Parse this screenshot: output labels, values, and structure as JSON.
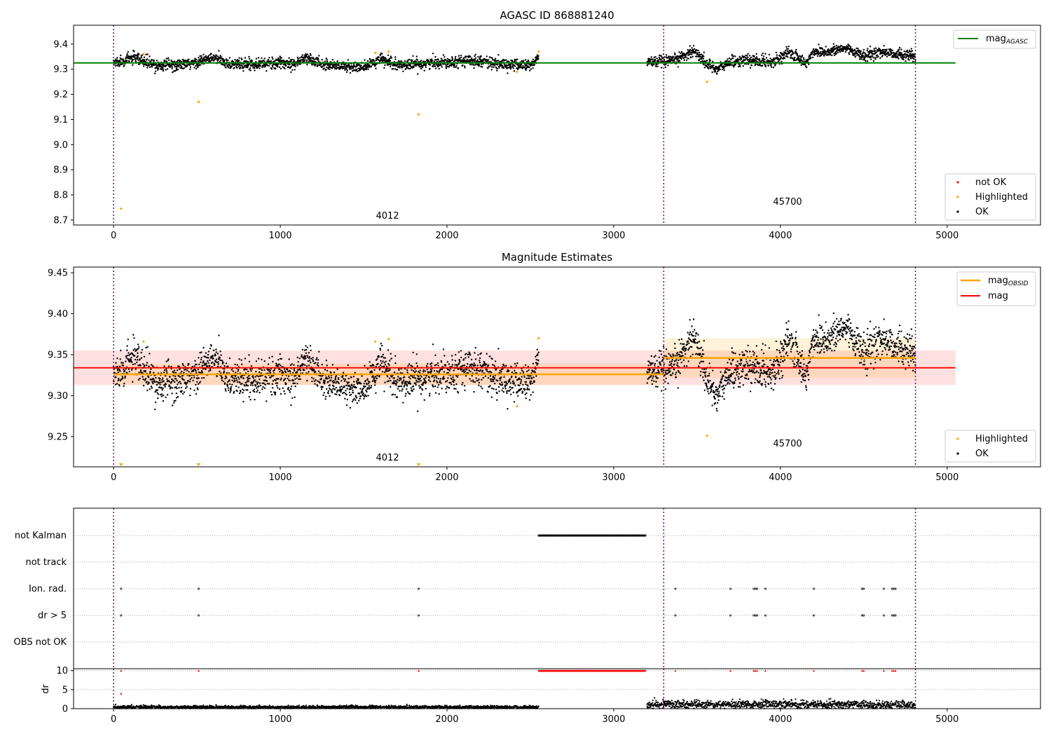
{
  "figure": {
    "panels": {
      "top": {
        "title": "AGASC ID 868881240",
        "legend_line": "mag",
        "legend_line_sub": "AGASC",
        "legend_points": [
          "not OK",
          "Highlighted",
          "OK"
        ],
        "annot_left": "4012",
        "annot_right": "45700"
      },
      "middle": {
        "title": "Magnitude Estimates",
        "legend_line1": "mag",
        "legend_line1_sub": "OBSID",
        "legend_line2": "mag",
        "legend_points": [
          "Highlighted",
          "OK"
        ],
        "annot_left": "4012",
        "annot_right": "45700"
      },
      "flags": {
        "rows": [
          "not Kalman",
          "not track",
          "Ion. rad.",
          "dr > 5",
          "OBS not OK"
        ],
        "dr_label": "dr"
      }
    },
    "colors": {
      "ok": "#000000",
      "highlighted": "#FFA500",
      "not_ok": "#FF0000",
      "agasc_line": "#008000",
      "obsid_line": "#FFA500",
      "mag_line": "#FF0000",
      "obs_boundary": "#800080"
    }
  },
  "chart_data": [
    {
      "type": "scatter",
      "title": "AGASC ID 868881240",
      "xlim": [
        -240,
        5560
      ],
      "ylim": [
        8.68,
        9.475
      ],
      "xticks": [
        0,
        1000,
        2000,
        3000,
        4000,
        5000
      ],
      "yticks": [
        8.7,
        8.8,
        8.9,
        9.0,
        9.1,
        9.2,
        9.3,
        9.4
      ],
      "ytick_labels": [
        "8.7",
        "8.8",
        "8.9",
        "9.0",
        "9.1",
        "9.2",
        "9.3",
        "9.4"
      ],
      "legend": "top-right / lower-right",
      "hlines": [
        {
          "name": "mag_AGASC",
          "y": 9.325,
          "x": [
            -240,
            5050
          ],
          "color": "#008000"
        }
      ],
      "vlines": [
        0,
        3300,
        4810
      ],
      "series": [
        {
          "name": "OK",
          "segments": [
            {
              "x": [
                0,
                2550
              ],
              "levels": [
                [
                  0,
                  9.325
                ],
                [
                  120,
                  9.345
                ],
                [
                  250,
                  9.315
                ],
                [
                  450,
                  9.32
                ],
                [
                  600,
                  9.345
                ],
                [
                  700,
                  9.32
                ],
                [
                  1100,
                  9.325
                ],
                [
                  1150,
                  9.345
                ],
                [
                  1250,
                  9.32
                ],
                [
                  1500,
                  9.305
                ],
                [
                  1600,
                  9.34
                ],
                [
                  1700,
                  9.315
                ],
                [
                  2000,
                  9.33
                ],
                [
                  2200,
                  9.335
                ],
                [
                  2300,
                  9.32
                ],
                [
                  2500,
                  9.315
                ],
                [
                  2550,
                  9.345
                ]
              ]
            },
            {
              "x": [
                3200,
                4810
              ],
              "levels": [
                [
                  3200,
                  9.33
                ],
                [
                  3350,
                  9.33
                ],
                [
                  3480,
                  9.375
                ],
                [
                  3560,
                  9.32
                ],
                [
                  3620,
                  9.3
                ],
                [
                  3700,
                  9.33
                ],
                [
                  3800,
                  9.335
                ],
                [
                  3950,
                  9.33
                ],
                [
                  4050,
                  9.365
                ],
                [
                  4100,
                  9.35
                ],
                [
                  4150,
                  9.32
                ],
                [
                  4200,
                  9.37
                ],
                [
                  4300,
                  9.37
                ],
                [
                  4400,
                  9.385
                ],
                [
                  4500,
                  9.35
                ],
                [
                  4600,
                  9.37
                ],
                [
                  4810,
                  9.35
                ]
              ]
            }
          ]
        },
        {
          "name": "Highlighted",
          "points": [
            [
              45,
              8.745
            ],
            [
              510,
              9.17
            ],
            [
              1830,
              9.12
            ],
            [
              3560,
              9.25
            ],
            [
              2420,
              9.29
            ],
            [
              180,
              9.36
            ],
            [
              1570,
              9.365
            ],
            [
              1650,
              9.37
            ],
            [
              2550,
              9.37
            ]
          ]
        },
        {
          "name": "not OK",
          "points": []
        }
      ],
      "annotations": [
        {
          "text": "4012",
          "x": 1650,
          "y": 8.71
        },
        {
          "text": "45700",
          "x": 4050,
          "y": 8.765
        }
      ]
    },
    {
      "type": "scatter",
      "title": "Magnitude Estimates",
      "xlim": [
        -240,
        5560
      ],
      "ylim": [
        9.213,
        9.457
      ],
      "xticks": [
        0,
        1000,
        2000,
        3000,
        4000,
        5000
      ],
      "yticks": [
        9.25,
        9.3,
        9.35,
        9.4,
        9.45
      ],
      "ytick_labels": [
        "9.25",
        "9.30",
        "9.35",
        "9.40",
        "9.45"
      ],
      "hlines": [
        {
          "name": "mag_OBSID",
          "y": 9.326,
          "x": [
            0,
            3300
          ],
          "band": [
            9.313,
            9.339
          ],
          "color": "#FFA500"
        },
        {
          "name": "mag_OBSID",
          "y": 9.346,
          "x": [
            3300,
            4810
          ],
          "band": [
            9.322,
            9.37
          ],
          "color": "#FFA500"
        },
        {
          "name": "mag",
          "y": 9.334,
          "x": [
            -240,
            5050
          ],
          "band": [
            9.313,
            9.355
          ],
          "color": "#FF0000"
        }
      ],
      "vlines": [
        0,
        3300,
        4810
      ],
      "series": [
        {
          "name": "OK",
          "segments": [
            {
              "x": [
                0,
                2550
              ],
              "levels": [
                [
                  0,
                  9.325
                ],
                [
                  120,
                  9.345
                ],
                [
                  250,
                  9.315
                ],
                [
                  450,
                  9.32
                ],
                [
                  600,
                  9.345
                ],
                [
                  700,
                  9.32
                ],
                [
                  1100,
                  9.325
                ],
                [
                  1150,
                  9.345
                ],
                [
                  1250,
                  9.32
                ],
                [
                  1500,
                  9.305
                ],
                [
                  1600,
                  9.34
                ],
                [
                  1700,
                  9.315
                ],
                [
                  2000,
                  9.33
                ],
                [
                  2200,
                  9.335
                ],
                [
                  2300,
                  9.32
                ],
                [
                  2500,
                  9.315
                ],
                [
                  2550,
                  9.345
                ]
              ]
            },
            {
              "x": [
                3200,
                4810
              ],
              "levels": [
                [
                  3200,
                  9.33
                ],
                [
                  3350,
                  9.33
                ],
                [
                  3480,
                  9.375
                ],
                [
                  3560,
                  9.32
                ],
                [
                  3620,
                  9.3
                ],
                [
                  3700,
                  9.33
                ],
                [
                  3800,
                  9.335
                ],
                [
                  3950,
                  9.33
                ],
                [
                  4050,
                  9.365
                ],
                [
                  4100,
                  9.35
                ],
                [
                  4150,
                  9.32
                ],
                [
                  4200,
                  9.37
                ],
                [
                  4300,
                  9.37
                ],
                [
                  4400,
                  9.385
                ],
                [
                  4500,
                  9.35
                ],
                [
                  4600,
                  9.37
                ],
                [
                  4810,
                  9.35
                ]
              ]
            }
          ]
        },
        {
          "name": "Highlighted",
          "points": [
            [
              3560,
              9.251
            ],
            [
              2420,
              9.287
            ],
            [
              180,
              9.366
            ],
            [
              1570,
              9.366
            ],
            [
              1650,
              9.369
            ],
            [
              2550,
              9.37
            ]
          ],
          "below_axis_markers": [
            45,
            510,
            1830
          ]
        }
      ],
      "annotations": [
        {
          "text": "4012",
          "x": 1650,
          "y": 9.222
        },
        {
          "text": "45700",
          "x": 4050,
          "y": 9.238
        }
      ]
    },
    {
      "type": "scatter",
      "title": "",
      "xlim": [
        -240,
        5560
      ],
      "categories": [
        "not Kalman",
        "not track",
        "Ion. rad.",
        "dr > 5",
        "OBS not OK"
      ],
      "flags": {
        "not Kalman": {
          "ranges": [
            [
              2550,
              3190
            ]
          ]
        },
        "not track": {
          "ranges": []
        },
        "Ion. rad.": {
          "points": [
            45,
            510,
            1830,
            3370,
            3700,
            3840,
            3850,
            3860,
            3910,
            4200,
            4490,
            4500,
            4620,
            4670,
            4680,
            4690
          ]
        },
        "dr > 5": {
          "points": [
            45,
            510,
            1830,
            3370,
            3700,
            3840,
            3850,
            3860,
            3910,
            4200,
            4490,
            4500,
            4620,
            4670,
            4680,
            4690
          ]
        },
        "OBS not OK": {
          "ranges": []
        }
      },
      "vlines": [
        0,
        3300,
        4810
      ]
    },
    {
      "type": "scatter",
      "title": "",
      "ylabel": "dr",
      "xlim": [
        -240,
        5560
      ],
      "ylim": [
        0,
        10.5
      ],
      "xticks": [
        0,
        1000,
        2000,
        3000,
        4000,
        5000
      ],
      "yticks": [
        0,
        5,
        10
      ],
      "series": [
        {
          "name": "OK",
          "segments": [
            {
              "x": [
                0,
                2550
              ],
              "level": 0.4
            },
            {
              "x": [
                3200,
                4810
              ],
              "level": 1.1
            }
          ]
        },
        {
          "name": "not OK",
          "points": [
            [
              45,
              10
            ],
            [
              45,
              4
            ],
            [
              510,
              10
            ],
            [
              1830,
              10
            ],
            [
              3370,
              10
            ],
            [
              3700,
              10
            ],
            [
              3840,
              10
            ],
            [
              3850,
              10
            ],
            [
              3860,
              10
            ],
            [
              3910,
              10
            ],
            [
              4200,
              10
            ],
            [
              4490,
              10
            ],
            [
              4500,
              10
            ],
            [
              4620,
              10
            ],
            [
              4670,
              10
            ],
            [
              4680,
              10
            ],
            [
              4690,
              10
            ]
          ],
          "range_at_10": [
            2550,
            3190
          ]
        }
      ],
      "vlines": [
        0,
        3300,
        4810
      ]
    }
  ]
}
